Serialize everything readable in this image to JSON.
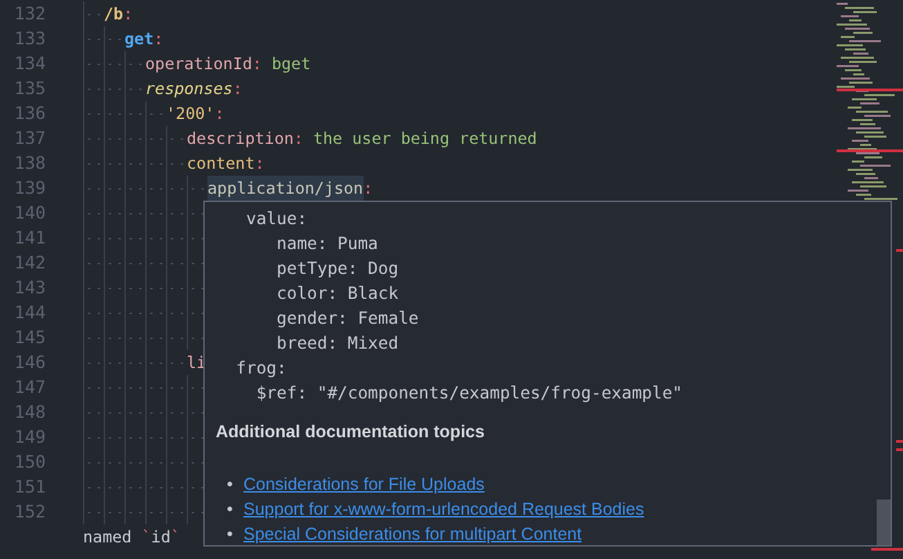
{
  "editor": {
    "lines": [
      {
        "number": "132",
        "tokens": [
          {
            "kind": "path",
            "text": "/b"
          },
          {
            "kind": "punct",
            "text": ":"
          }
        ]
      },
      {
        "number": "133",
        "tokens": [
          {
            "kind": "method",
            "text": "get"
          },
          {
            "kind": "punct",
            "text": ":"
          }
        ]
      },
      {
        "number": "134",
        "tokens": [
          {
            "kind": "key",
            "text": "operationId"
          },
          {
            "kind": "punct",
            "text": ": "
          },
          {
            "kind": "value",
            "text": "bget"
          }
        ]
      },
      {
        "number": "135",
        "tokens": [
          {
            "kind": "italic-key",
            "text": "responses"
          },
          {
            "kind": "punct",
            "text": ":"
          }
        ]
      },
      {
        "number": "136",
        "tokens": [
          {
            "kind": "quoted",
            "text": "'200'"
          },
          {
            "kind": "punct",
            "text": ":"
          }
        ]
      },
      {
        "number": "137",
        "tokens": [
          {
            "kind": "key",
            "text": "description"
          },
          {
            "kind": "punct",
            "text": ": "
          },
          {
            "kind": "value",
            "text": "the user being returned"
          }
        ]
      },
      {
        "number": "138",
        "tokens": [
          {
            "kind": "quoted",
            "text": "content"
          },
          {
            "kind": "punct",
            "text": ":"
          }
        ]
      },
      {
        "number": "139",
        "tokens": [
          {
            "kind": "highlight",
            "text": "application/json"
          },
          {
            "kind": "punct",
            "text": ":"
          }
        ]
      },
      {
        "number": "140"
      },
      {
        "number": "141"
      },
      {
        "number": "142"
      },
      {
        "number": "143"
      },
      {
        "number": "144"
      },
      {
        "number": "145"
      },
      {
        "number": "146",
        "tokens": [
          {
            "kind": "key",
            "text": "li"
          }
        ]
      },
      {
        "number": "147"
      },
      {
        "number": "148"
      },
      {
        "number": "149"
      },
      {
        "number": "150"
      },
      {
        "number": "151"
      },
      {
        "number": "152"
      },
      {
        "tokens": [
          {
            "kind": "plain",
            "text": "named "
          },
          {
            "kind": "punct",
            "text": "`"
          },
          {
            "kind": "plain",
            "text": "id"
          },
          {
            "kind": "punct",
            "text": "`"
          }
        ]
      }
    ]
  },
  "hover_popup": {
    "code_lines": [
      "   value:",
      "      name: Puma",
      "      petType: Dog",
      "      color: Black",
      "      gender: Female",
      "      breed: Mixed",
      "  frog:",
      "    $ref: \"#/components/examples/frog-example\""
    ],
    "heading": "Additional documentation topics",
    "links": [
      {
        "bullet": "•",
        "text": "Considerations for File Uploads"
      },
      {
        "bullet": "•",
        "text": "Support for x-www-form-urlencoded Request Bodies"
      },
      {
        "bullet": "•",
        "text": "Special Considerations for multipart Content"
      }
    ]
  }
}
